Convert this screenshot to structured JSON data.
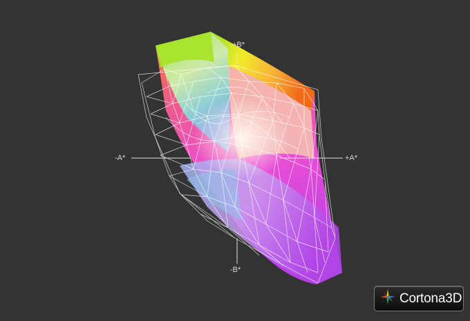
{
  "viewer": {
    "axis_labels": {
      "pos_b": "+B*",
      "neg_b": "-B*",
      "neg_a": "-A*",
      "pos_a": "+A*"
    },
    "brand": {
      "name": "Cortona",
      "suffix": "3D"
    },
    "colors": {
      "background": "#333333",
      "wireframe": "#ffffff"
    }
  }
}
